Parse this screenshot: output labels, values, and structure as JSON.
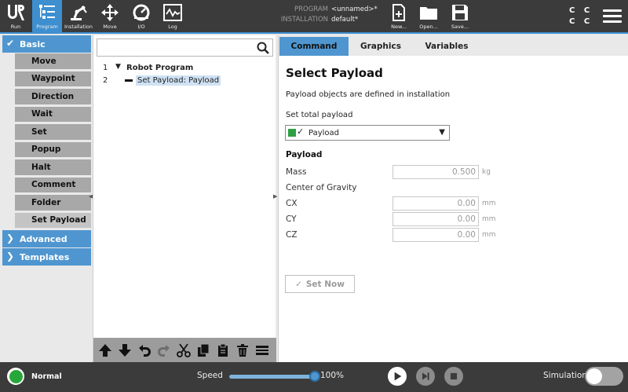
{
  "topbar": {
    "buttons": [
      {
        "label": "Run",
        "icon": "ur-logo-icon"
      },
      {
        "label": "Program",
        "icon": "program-icon",
        "active": true
      },
      {
        "label": "Installation",
        "icon": "robot-arm-icon"
      },
      {
        "label": "Move",
        "icon": "move-arrows-icon"
      },
      {
        "label": "I/O",
        "icon": "io-gauge-icon"
      },
      {
        "label": "Log",
        "icon": "log-waveform-icon"
      },
      {
        "label": "New...",
        "icon": "new-file-icon"
      },
      {
        "label": "Open...",
        "icon": "folder-icon"
      },
      {
        "label": "Save...",
        "icon": "save-disk-icon"
      }
    ],
    "program_label": "PROGRAM",
    "program_value": "<unnamed>*",
    "installation_label": "INSTALLATION",
    "installation_value": "default*",
    "cc_top": "C C",
    "cc_bottom": "C C"
  },
  "sidebar": {
    "basic_label": "Basic",
    "items": [
      "Move",
      "Waypoint",
      "Direction",
      "Wait",
      "Set",
      "Popup",
      "Halt",
      "Comment",
      "Folder",
      "Set Payload"
    ],
    "selected_item": "Set Payload",
    "advanced_label": "Advanced",
    "templates_label": "Templates"
  },
  "tree": {
    "search_placeholder": "",
    "rows": [
      {
        "num": "1",
        "text": "Robot Program"
      },
      {
        "num": "2",
        "text": "Set Payload: Payload"
      }
    ]
  },
  "tabs": [
    "Command",
    "Graphics",
    "Variables"
  ],
  "active_tab": "Command",
  "panel": {
    "title": "Select Payload",
    "description": "Payload objects are defined in installation",
    "set_total_label": "Set total payload",
    "dropdown_value": "Payload",
    "section_title": "Payload",
    "mass_label": "Mass",
    "mass_value": "0.500",
    "mass_unit": "kg",
    "cog_label": "Center of Gravity",
    "cx_label": "CX",
    "cx_value": "0.00",
    "cy_label": "CY",
    "cy_value": "0.00",
    "cz_label": "CZ",
    "cz_value": "0.00",
    "mm_unit": "mm",
    "set_now_label": "Set Now"
  },
  "footer": {
    "status": "Normal",
    "speed_label": "Speed",
    "speed_value": "100%",
    "speed_fraction": 1.0,
    "simulation_label": "Simulation",
    "simulation_on": false
  },
  "colors": {
    "accent": "#3d8fd0",
    "tab_active": "#4f96d0",
    "status_ok": "#28a83a",
    "topbar_bg": "#3b3b3b"
  }
}
